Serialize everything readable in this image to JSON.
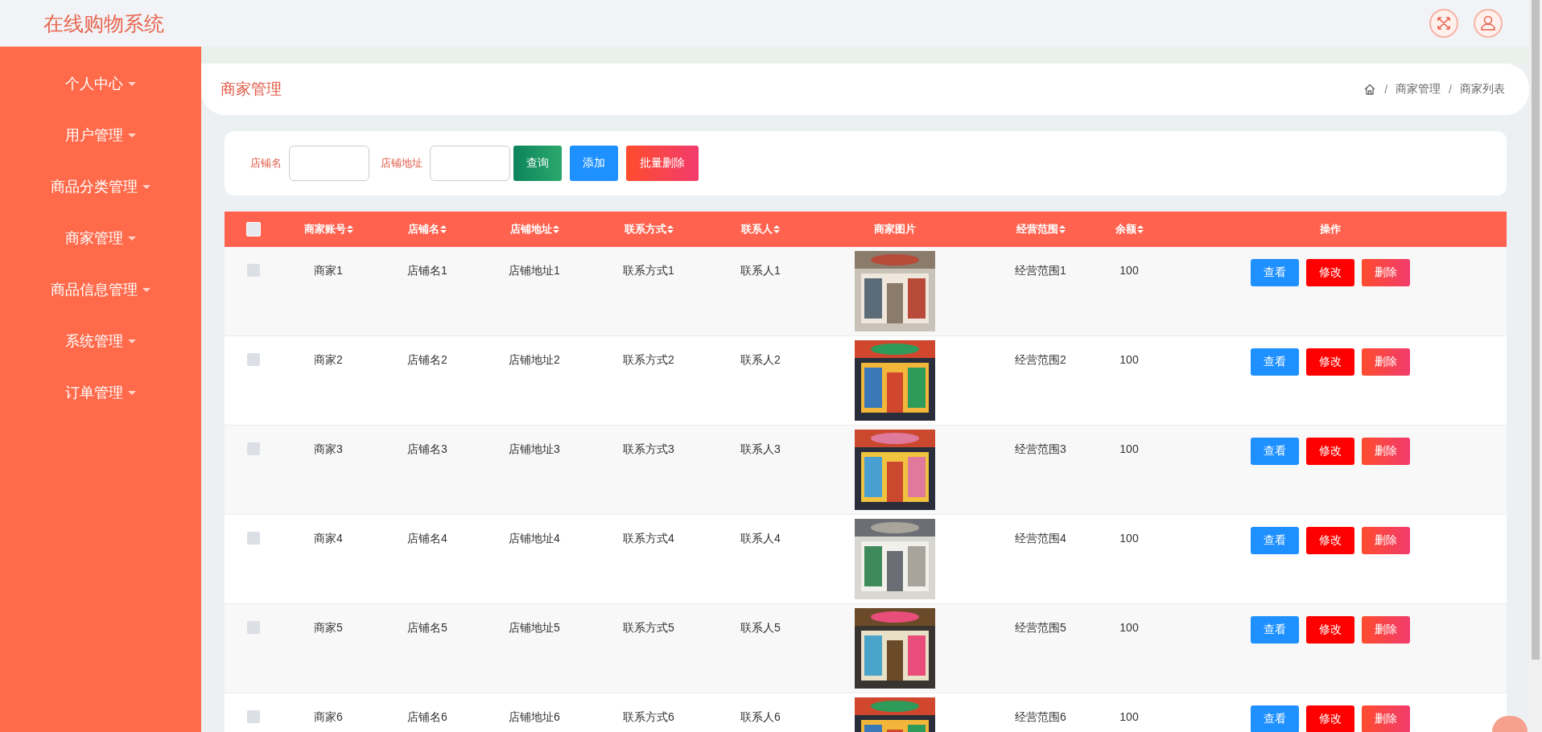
{
  "app_title": "在线购物系统",
  "sidebar": {
    "items": [
      {
        "label": "个人中心"
      },
      {
        "label": "用户管理"
      },
      {
        "label": "商品分类管理"
      },
      {
        "label": "商家管理"
      },
      {
        "label": "商品信息管理"
      },
      {
        "label": "系统管理"
      },
      {
        "label": "订单管理"
      }
    ]
  },
  "page_header": {
    "title": "商家管理",
    "breadcrumb_separator": "/",
    "breadcrumb": [
      "商家管理",
      "商家列表"
    ]
  },
  "filter": {
    "fields": [
      {
        "label": "店铺名"
      },
      {
        "label": "店铺地址"
      }
    ],
    "buttons": [
      {
        "label": "查询",
        "kind": "query"
      },
      {
        "label": "添加",
        "kind": "add"
      },
      {
        "label": "批量删除",
        "kind": "delete"
      }
    ]
  },
  "table": {
    "select_all_checked": false,
    "columns": [
      {
        "kind": "text",
        "label": "商家账号",
        "sortable": true
      },
      {
        "kind": "text",
        "label": "店铺名",
        "sortable": true
      },
      {
        "kind": "text",
        "label": "店铺地址",
        "sortable": true
      },
      {
        "kind": "text",
        "label": "联系方式",
        "sortable": true
      },
      {
        "kind": "text",
        "label": "联系人",
        "sortable": true
      },
      {
        "kind": "picture",
        "label": "商家图片",
        "sortable": false
      },
      {
        "kind": "text",
        "label": "经营范围",
        "sortable": true
      },
      {
        "kind": "text",
        "label": "余额",
        "sortable": true
      },
      {
        "kind": "actions",
        "label": "操作",
        "sortable": false
      }
    ],
    "rows": [
      {
        "checked": false,
        "values": [
          "商家1",
          "店铺名1",
          "店铺地址1",
          "联系方式1",
          "联系人1",
          "经营范围1",
          "100"
        ],
        "actions": [
          {
            "label": "查看",
            "kind": "view"
          },
          {
            "label": "修改",
            "kind": "edit"
          },
          {
            "label": "删除",
            "kind": "delete"
          }
        ]
      },
      {
        "checked": false,
        "values": [
          "商家2",
          "店铺名2",
          "店铺地址2",
          "联系方式2",
          "联系人2",
          "经营范围2",
          "100"
        ],
        "actions": [
          {
            "label": "查看",
            "kind": "view"
          },
          {
            "label": "修改",
            "kind": "edit"
          },
          {
            "label": "删除",
            "kind": "delete"
          }
        ]
      },
      {
        "checked": false,
        "values": [
          "商家3",
          "店铺名3",
          "店铺地址3",
          "联系方式3",
          "联系人3",
          "经营范围3",
          "100"
        ],
        "actions": [
          {
            "label": "查看",
            "kind": "view"
          },
          {
            "label": "修改",
            "kind": "edit"
          },
          {
            "label": "删除",
            "kind": "delete"
          }
        ]
      },
      {
        "checked": false,
        "values": [
          "商家4",
          "店铺名4",
          "店铺地址4",
          "联系方式4",
          "联系人4",
          "经营范围4",
          "100"
        ],
        "actions": [
          {
            "label": "查看",
            "kind": "view"
          },
          {
            "label": "修改",
            "kind": "edit"
          },
          {
            "label": "删除",
            "kind": "delete"
          }
        ]
      },
      {
        "checked": false,
        "values": [
          "商家5",
          "店铺名5",
          "店铺地址5",
          "联系方式5",
          "联系人5",
          "经营范围5",
          "100"
        ],
        "actions": [
          {
            "label": "查看",
            "kind": "view"
          },
          {
            "label": "修改",
            "kind": "edit"
          },
          {
            "label": "删除",
            "kind": "delete"
          }
        ]
      },
      {
        "checked": false,
        "values": [
          "商家6",
          "店铺名6",
          "店铺地址6",
          "联系方式6",
          "联系人6",
          "经营范围6",
          "100"
        ],
        "actions": [
          {
            "label": "查看",
            "kind": "view"
          },
          {
            "label": "修改",
            "kind": "edit"
          },
          {
            "label": "删除",
            "kind": "delete"
          }
        ]
      }
    ]
  }
}
